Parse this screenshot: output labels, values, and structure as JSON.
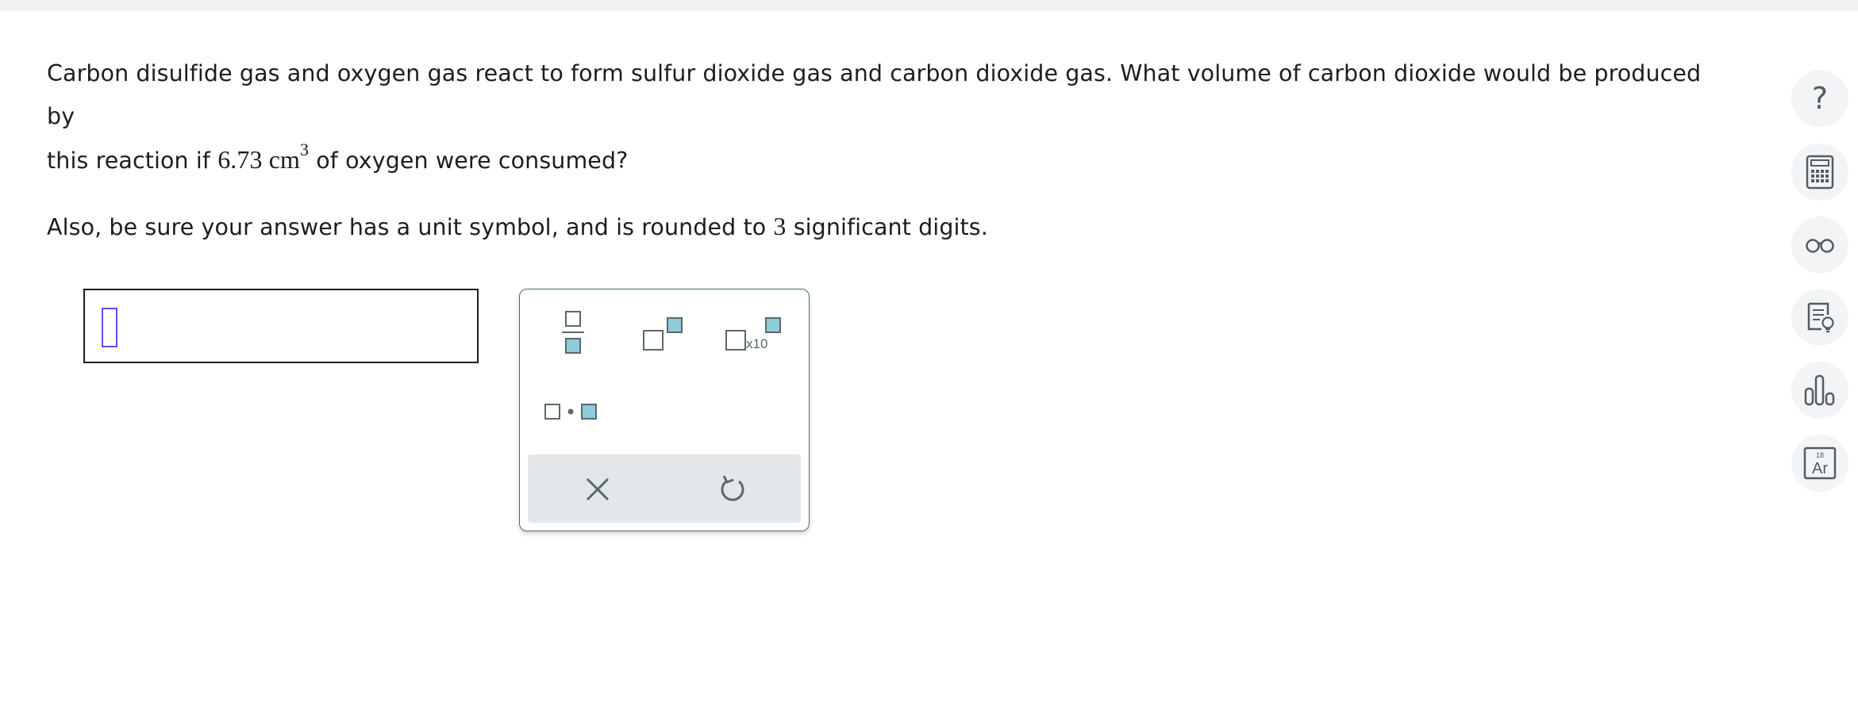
{
  "question": {
    "line1": "Carbon disulfide gas and oxygen gas react to form sulfur dioxide gas and carbon dioxide gas. What volume of carbon dioxide would be produced by",
    "line2_pre": "this reaction if ",
    "amount": "6.73",
    "unit": "cm",
    "unit_exp": "3",
    "line2_post": " of oxygen were consumed?",
    "p2_pre": "Also, be sure your answer has a unit symbol, and is rounded to ",
    "sig_figs": "3",
    "p2_post": " significant digits."
  },
  "answer": {
    "value": ""
  },
  "palette": {
    "times_ten_label": "x10"
  },
  "side_tools": {
    "help_glyph": "?",
    "periodic_number": "18",
    "periodic_symbol": "Ar"
  },
  "colors": {
    "accent_teal": "#8fcbd9",
    "icon_gray": "#5a6770",
    "cursor_purple": "#5a4ff2"
  }
}
